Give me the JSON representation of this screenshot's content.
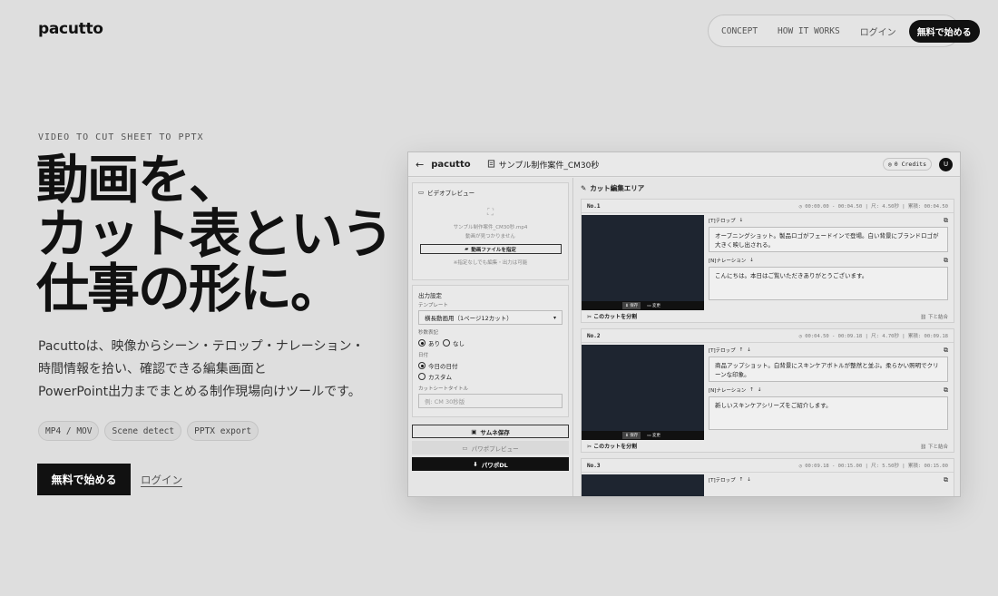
{
  "brand": {
    "logo": "pacutto"
  },
  "nav": {
    "links": [
      "CONCEPT",
      "HOW IT WORKS",
      "ログイン"
    ],
    "cta": "無料で始める"
  },
  "hero": {
    "eyebrow": "VIDEO TO CUT SHEET TO PPTX",
    "headline": [
      "動画を、",
      "カット表という",
      "仕事の形に。"
    ],
    "description": [
      "Pacuttoは、映像からシーン・テロップ・ナレーション・",
      "時間情報を拾い、確認できる編集画面と",
      "PowerPoint出力までまとめる制作現場向けツールです。"
    ],
    "pills": [
      "MP4 / MOV",
      "Scene detect",
      "PPTX export"
    ],
    "cta": "無料で始める",
    "login": "ログイン"
  },
  "app": {
    "logo": "pacutto",
    "file_title": "サンプル制作案件_CM30秒",
    "credits": "0 Credits",
    "avatar": "U",
    "preview": {
      "title": "ビデオプレビュー",
      "filename": "サンプル制作案件_CM30秒.mp4",
      "status": "動画が見つかりません",
      "file_button": "動画ファイルを指定",
      "hint": "※指定なしでも編集・出力は可能"
    },
    "output": {
      "title": "出力設定",
      "template_label": "テンプレート",
      "template_value": "横長動画用（1ページ12カット）",
      "seconds_label": "秒数表記",
      "seconds_options": [
        "あり",
        "なし"
      ],
      "date_label": "日付",
      "date_options": [
        "今日の日付",
        "カスタム"
      ],
      "sheet_title_label": "カットシートタイトル",
      "sheet_title_placeholder": "例: CM 30秒版",
      "save_button": "サムネ保存",
      "preview_button": "パワポプレビュー",
      "download_button": "パワポDL"
    },
    "edit_area": {
      "title": "カット編集エリア",
      "cuts": [
        {
          "no": "No.1",
          "time": "00:00.00 - 00:04.50 | 尺: 4.50秒 | 累積: 00:04.50",
          "telop_label": "[T]テロップ",
          "telop": "オープニングショット。製品ロゴがフェードインで登場。白い背景にブランドロゴが大きく映し出される。",
          "narration_label": "[N]ナレーション",
          "narration": "こんにちは。本日はご覧いただきありがとうございます。",
          "split": "このカットを分割",
          "merge": "下と結合",
          "thumb_save": "保存",
          "thumb_change": "変更"
        },
        {
          "no": "No.2",
          "time": "00:04.50 - 00:09.18 | 尺: 4.70秒 | 累積: 00:09.18",
          "telop_label": "[T]テロップ",
          "telop": "商品アップショット。白背景にスキンケアボトルが整然と並ぶ。柔らかい照明でクリーンな印象。",
          "narration_label": "[N]ナレーション",
          "narration": "新しいスキンケアシリーズをご紹介します。",
          "split": "このカットを分割",
          "merge": "下と結合",
          "thumb_save": "保存",
          "thumb_change": "変更"
        },
        {
          "no": "No.3",
          "time": "00:09.18 - 00:15.00 | 尺: 5.50秒 | 累積: 00:15.00",
          "telop_label": "[T]テロップ"
        }
      ]
    }
  }
}
